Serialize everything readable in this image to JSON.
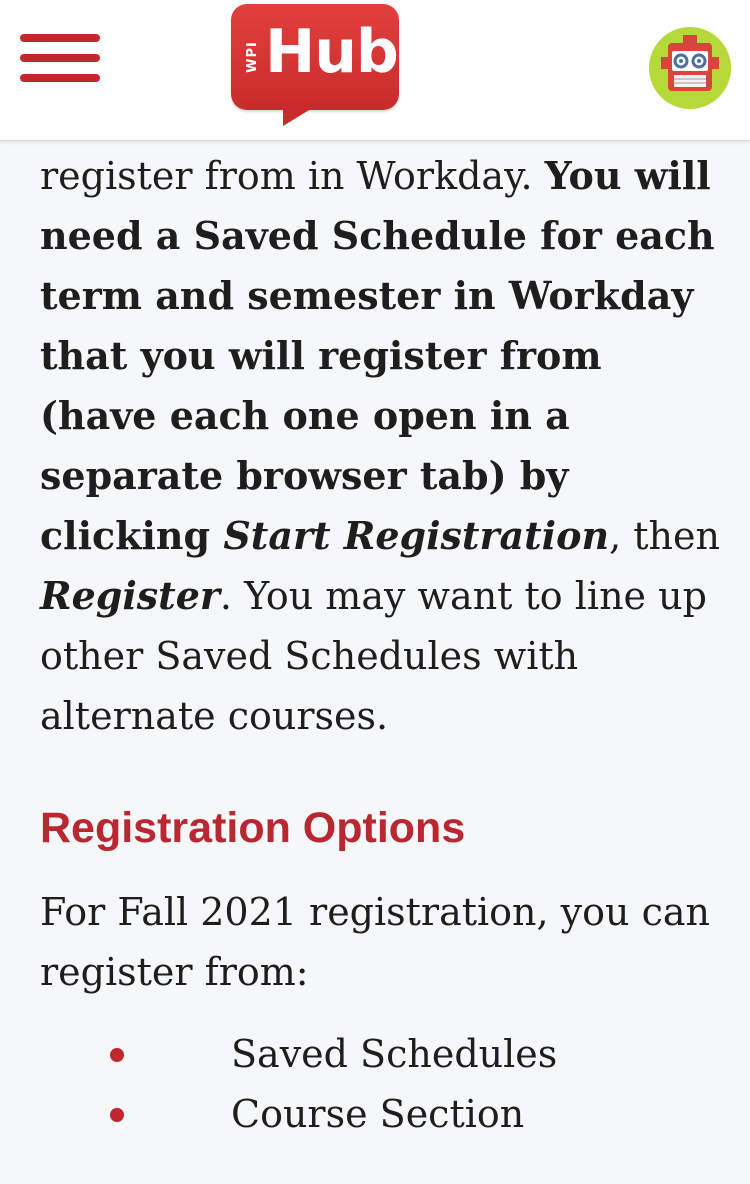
{
  "header": {
    "logo": {
      "small_text": "WPI",
      "main_text": "Hub"
    },
    "menu_icon": "hamburger-menu-icon",
    "avatar_icon": "robot-avatar-icon"
  },
  "content": {
    "para1": {
      "line_start": "register from in Workday. ",
      "bold_text": "You will need a Saved Schedule for each term and semester in Workday that you will register from (have each one open in a separate browser tab) by clicking ",
      "italic1": "Start Registration",
      "mid": ", then ",
      "italic2": "Register",
      "period": ".",
      "rest": " You may want to line up other Saved Schedules with alternate courses."
    },
    "heading": "Registration Options",
    "para2": "For Fall 2021 registration, you can register from:",
    "list": [
      "Saved Schedules",
      "Course Section"
    ]
  },
  "colors": {
    "accent_red": "#c1272d",
    "heading_red": "#b92830",
    "avatar_green": "#b6d93a",
    "background": "#f6f7f9"
  }
}
